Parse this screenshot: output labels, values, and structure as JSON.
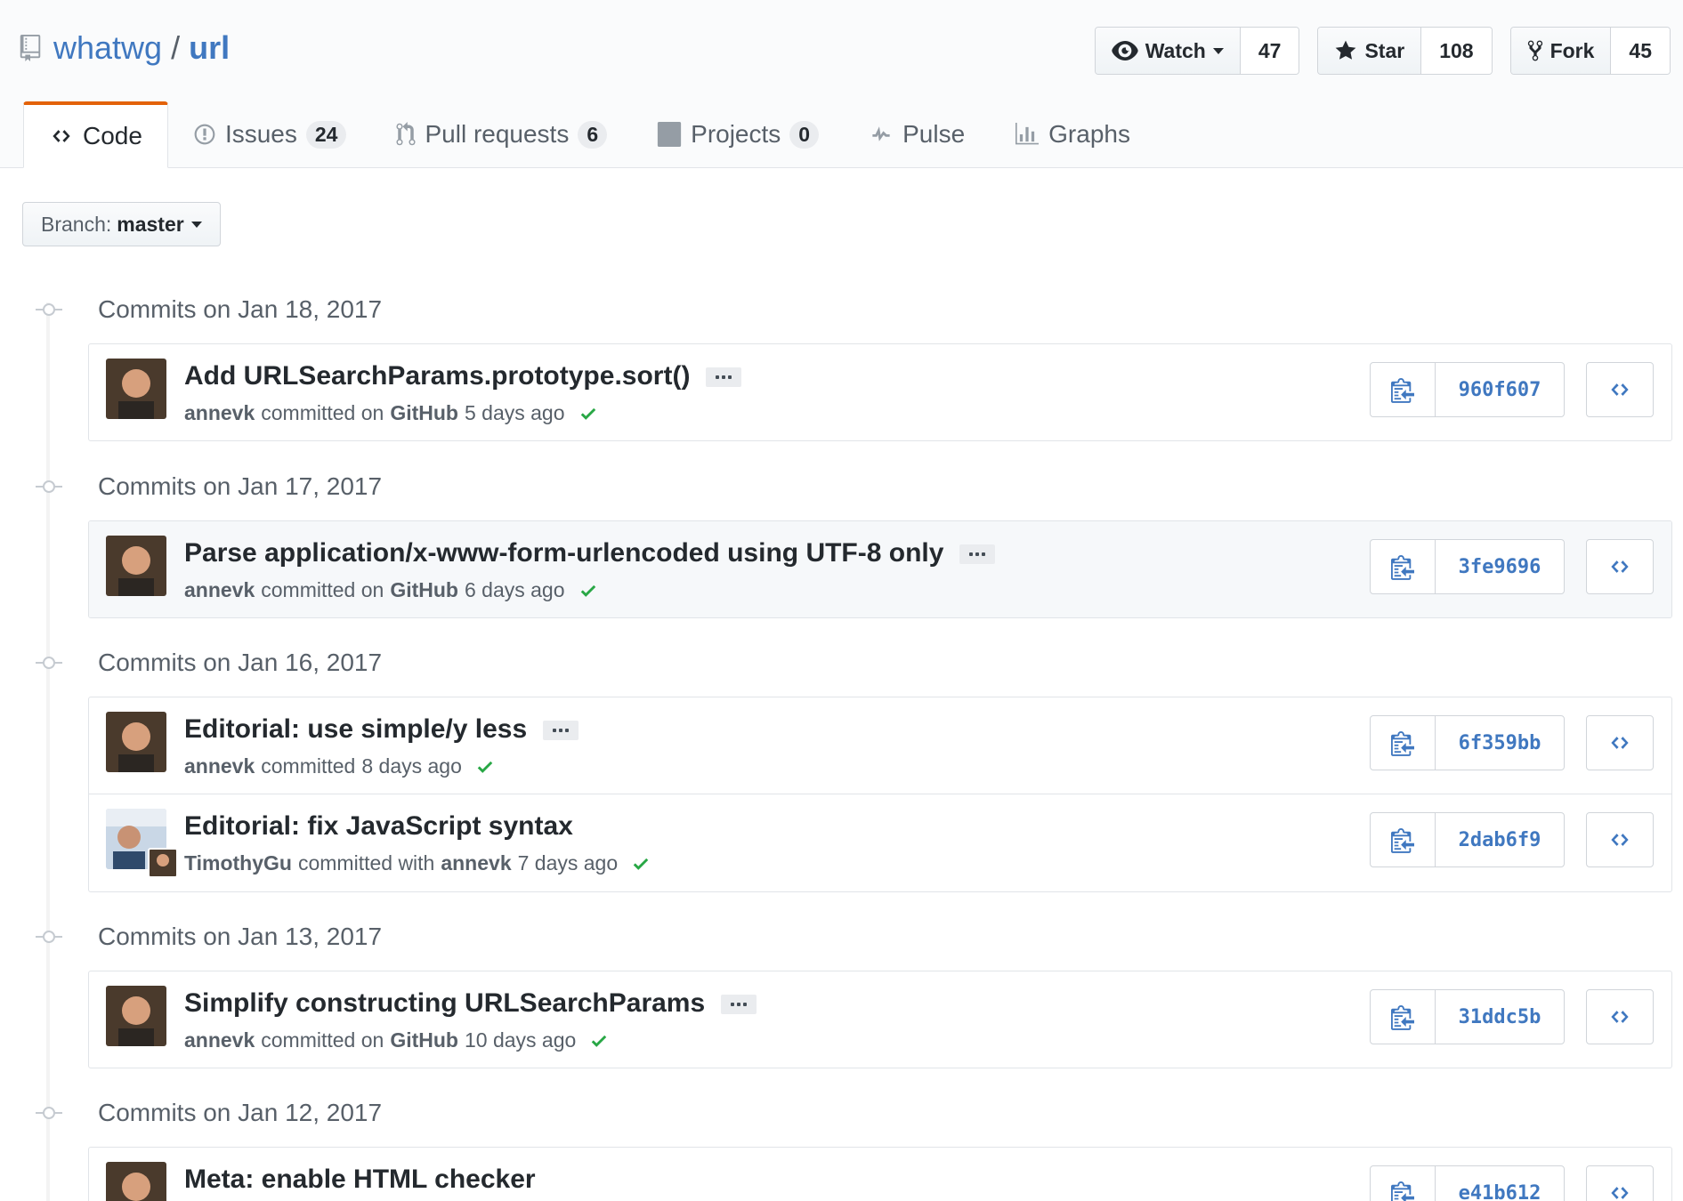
{
  "repo": {
    "owner": "whatwg",
    "separator": "/",
    "name": "url"
  },
  "actions": {
    "watch": {
      "label": "Watch",
      "count": "47",
      "icon": "eye-icon"
    },
    "star": {
      "label": "Star",
      "count": "108",
      "icon": "star-icon"
    },
    "fork": {
      "label": "Fork",
      "count": "45",
      "icon": "fork-icon"
    }
  },
  "tabs": [
    {
      "label": "Code",
      "icon": "code-icon",
      "active": true
    },
    {
      "label": "Issues",
      "count": "24",
      "icon": "issue-icon"
    },
    {
      "label": "Pull requests",
      "count": "6",
      "icon": "pull-request-icon"
    },
    {
      "label": "Projects",
      "count": "0",
      "icon": "project-icon"
    },
    {
      "label": "Pulse",
      "icon": "pulse-icon"
    },
    {
      "label": "Graphs",
      "icon": "graph-icon"
    }
  ],
  "branch": {
    "prefix": "Branch:",
    "name": "master"
  },
  "days": [
    {
      "label": "Commits on Jan 18, 2017",
      "commits": [
        {
          "title": "Add URLSearchParams.prototype.sort()",
          "author": "annevk",
          "verb": "committed on",
          "via": "GitHub",
          "time": "5 days ago",
          "sha": "960f607"
        }
      ]
    },
    {
      "label": "Commits on Jan 17, 2017",
      "commits": [
        {
          "title": "Parse application/x-www-form-urlencoded using UTF-8 only",
          "author": "annevk",
          "verb": "committed on",
          "via": "GitHub",
          "time": "6 days ago",
          "sha": "3fe9696"
        }
      ]
    },
    {
      "label": "Commits on Jan 16, 2017",
      "commits": [
        {
          "title": "Editorial: use simple/y less",
          "author": "annevk",
          "verb": "committed",
          "via": "",
          "time": "8 days ago",
          "sha": "6f359bb"
        },
        {
          "title": "Editorial: fix JavaScript syntax",
          "author": "TimothyGu",
          "verb": "committed with",
          "via": "annevk",
          "time": "7 days ago",
          "sha": "2dab6f9"
        }
      ]
    },
    {
      "label": "Commits on Jan 13, 2017",
      "commits": [
        {
          "title": "Simplify constructing URLSearchParams",
          "author": "annevk",
          "verb": "committed on",
          "via": "GitHub",
          "time": "10 days ago",
          "sha": "31ddc5b"
        }
      ]
    },
    {
      "label": "Commits on Jan 12, 2017",
      "commits": [
        {
          "title": "Meta: enable HTML checker",
          "sha": "e41b612"
        }
      ]
    }
  ],
  "colors": {
    "link": "#4078c0",
    "accent_tab": "#e36209",
    "success": "#28a745",
    "muted": "#586069"
  }
}
